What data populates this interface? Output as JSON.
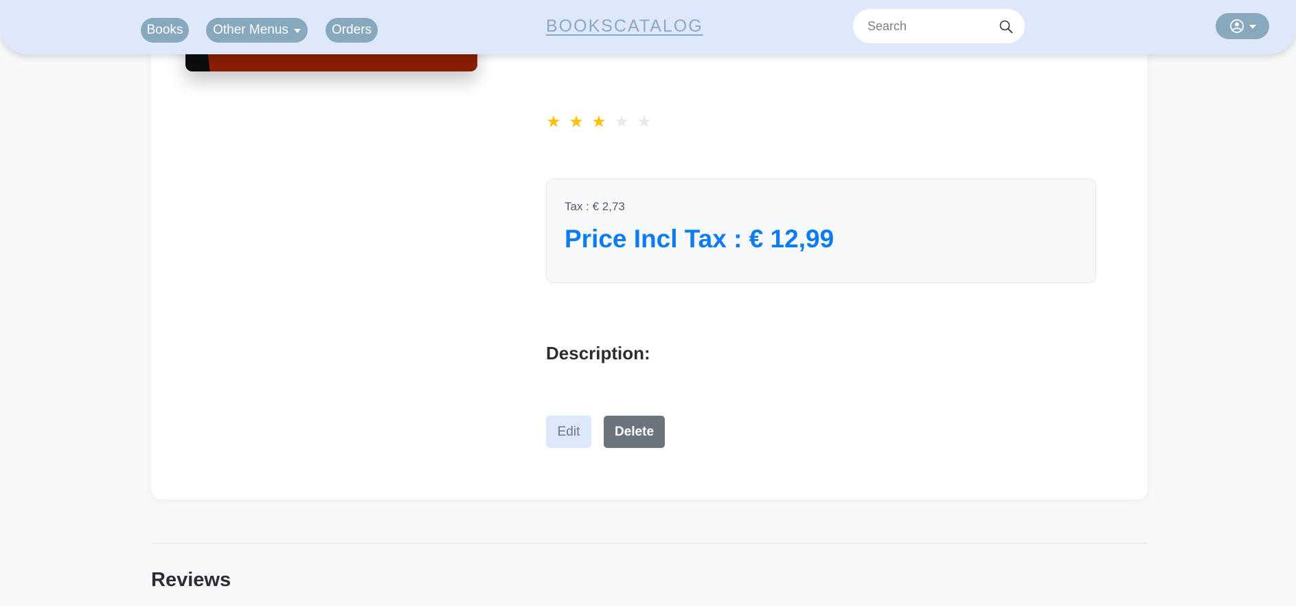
{
  "nav": {
    "items": [
      {
        "label": "Books"
      },
      {
        "label": "Other Menus"
      },
      {
        "label": "Orders"
      }
    ],
    "brand": "BOOKSCATALOG",
    "search_placeholder": "Search",
    "icons": {
      "search": "search-icon",
      "user": "user-circle-icon",
      "dropdown": "caret-down-icon"
    }
  },
  "product": {
    "rating": {
      "value": 3,
      "max": 5
    },
    "tax": "Tax : € 2,73",
    "price": "Price Incl Tax : € 12,99",
    "description_label": "Description:",
    "actions": {
      "edit": "Edit",
      "delete": "Delete"
    }
  },
  "reviews": {
    "title": "Reviews"
  },
  "colors": {
    "accent": "#0d7cf0",
    "star_on": "#ffc107",
    "star_off": "#e6e8eb",
    "nav_bg": "#dfe8fb",
    "nav_pill": "#87a8bd",
    "delete_bg": "#6c757d",
    "edit_bg": "#dde8fb",
    "cover": "#861e05"
  }
}
